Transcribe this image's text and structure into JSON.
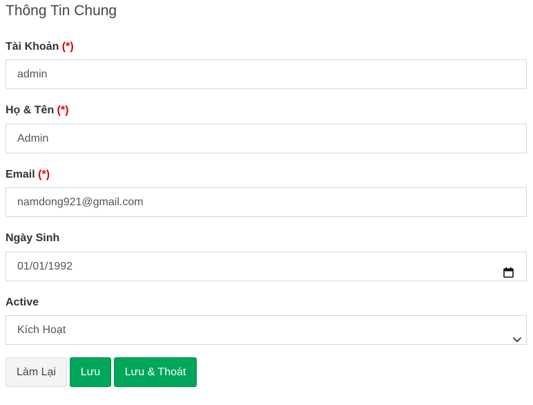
{
  "page": {
    "title": "Thông Tin Chung"
  },
  "fields": {
    "account": {
      "label": "Tài Khoản",
      "required_mark": "(*)",
      "value": "admin"
    },
    "fullname": {
      "label": "Họ & Tên",
      "required_mark": "(*)",
      "value": "Admin"
    },
    "email": {
      "label": "Email",
      "required_mark": "(*)",
      "value": "namdong921@gmail.com"
    },
    "birthday": {
      "label": "Ngày Sinh",
      "value": "01/01/1992"
    },
    "active": {
      "label": "Active",
      "selected": "Kích Hoạt"
    }
  },
  "buttons": {
    "reset": "Làm Lại",
    "save": "Lưu",
    "save_exit": "Lưu & Thoát"
  },
  "colors": {
    "required": "#e00000",
    "primary_green": "#00a65a",
    "border": "#d2d6de"
  },
  "icons": {
    "date": "calendar-icon",
    "select": "chevron-down-icon"
  }
}
